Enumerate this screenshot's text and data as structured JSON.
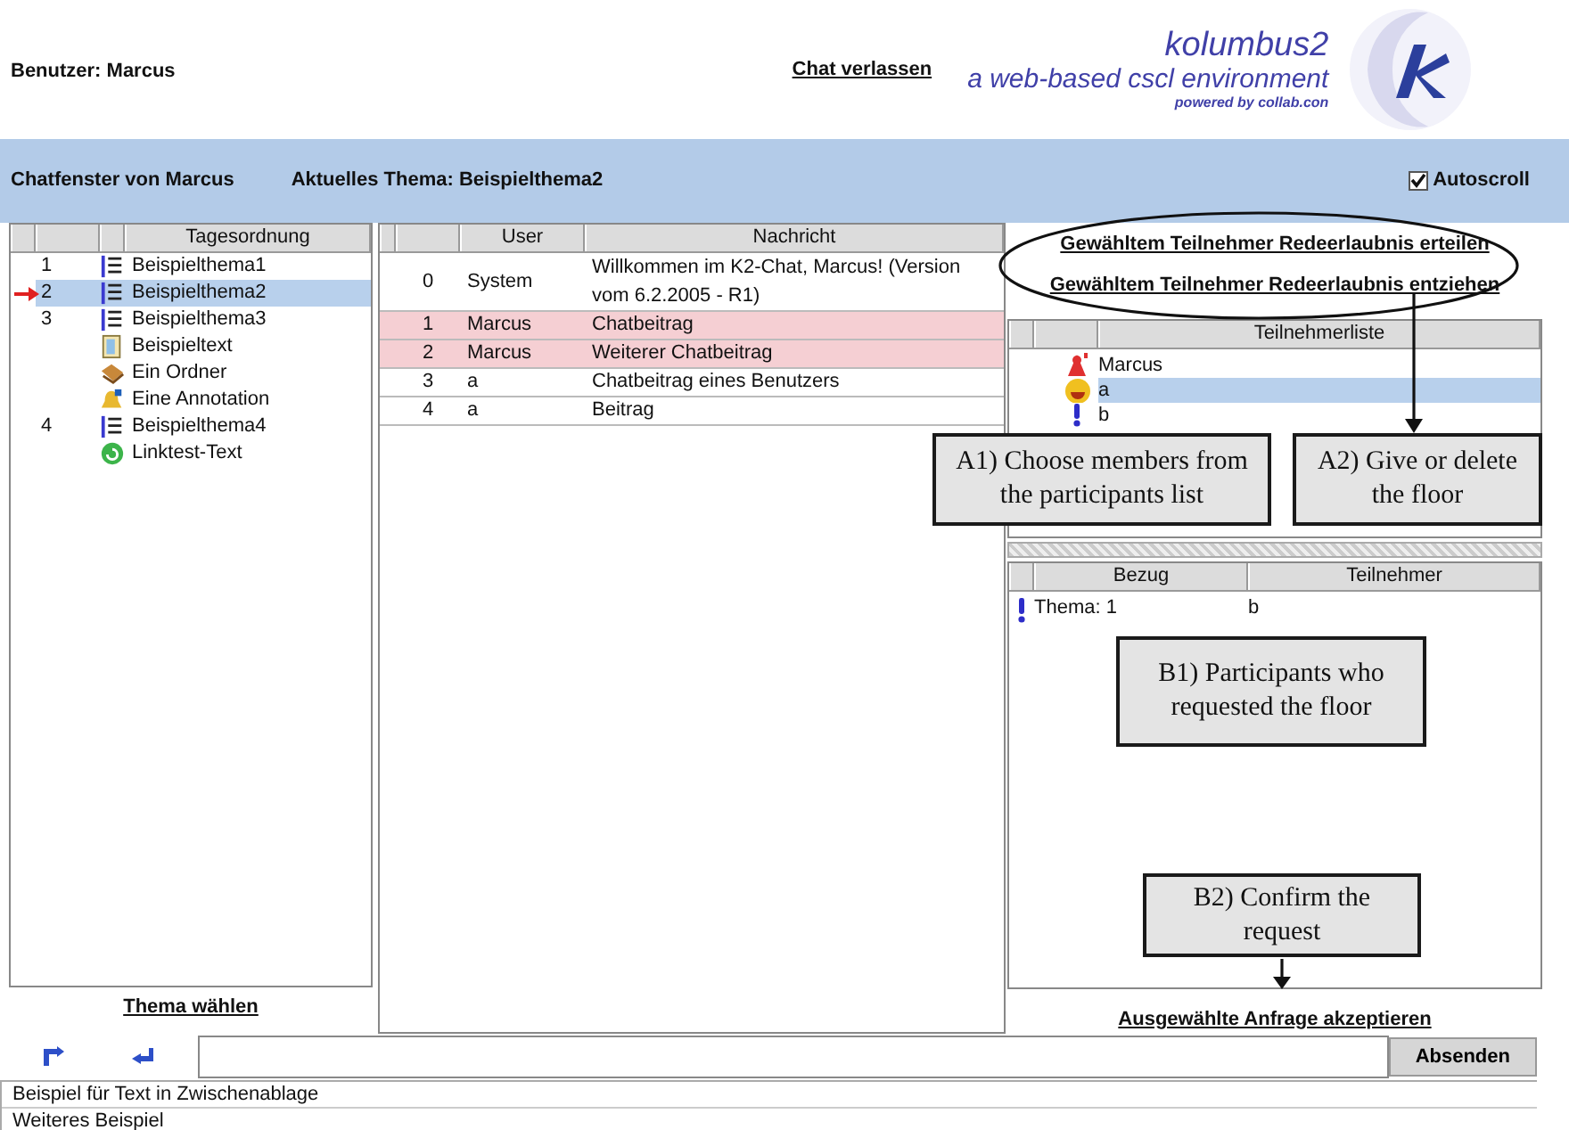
{
  "header": {
    "user": "Benutzer: Marcus",
    "leave_link": "Chat verlassen",
    "logo": {
      "title": "kolumbus2",
      "subtitle": "a web-based cscl environment",
      "credit": "powered by collab.con"
    }
  },
  "topic_bar": {
    "window_label": "Chatfenster von Marcus",
    "current_topic": "Aktuelles Thema: Beispielthema2",
    "autoscroll": {
      "label": "Autoscroll",
      "checked": true
    }
  },
  "agenda": {
    "column": "Tagesordnung",
    "items": [
      {
        "number": "1",
        "kind": "topic",
        "label": "Beispielthema1",
        "selected": false,
        "current": false
      },
      {
        "number": "2",
        "kind": "topic",
        "label": "Beispielthema2",
        "selected": true,
        "current": true
      },
      {
        "number": "3",
        "kind": "topic",
        "label": "Beispielthema3",
        "selected": false,
        "current": false
      },
      {
        "kind": "text",
        "label": "Beispieltext",
        "selected": false,
        "current": false
      },
      {
        "kind": "folder",
        "label": "Ein Ordner",
        "selected": false,
        "current": false
      },
      {
        "kind": "annotation",
        "label": "Eine Annotation",
        "selected": false,
        "current": false
      },
      {
        "number": "4",
        "kind": "topic",
        "label": "Beispielthema4",
        "selected": false,
        "current": false
      },
      {
        "kind": "link",
        "label": "Linktest-Text",
        "selected": false,
        "current": false
      }
    ],
    "link": "Thema wählen"
  },
  "chat": {
    "columns": [
      "User",
      "Nachricht"
    ],
    "messages": [
      {
        "number": "0",
        "user": "System",
        "text": "Willkommen im K2-Chat, Marcus! (Version vom 6.2.2005 - R1)",
        "own": false
      },
      {
        "number": "1",
        "user": "Marcus",
        "text": "Chatbeitrag",
        "own": true
      },
      {
        "number": "2",
        "user": "Marcus",
        "text": "Weiterer Chatbeitrag",
        "own": true
      },
      {
        "number": "3",
        "user": "a",
        "text": "Chatbeitrag eines Benutzers",
        "own": false
      },
      {
        "number": "4",
        "user": "a",
        "text": "Beitrag",
        "own": false
      }
    ]
  },
  "participants": {
    "links": [
      "Gewähltem Teilnehmer Redeerlaubnis erteilen",
      "Gewähltem Teilnehmer Redeerlaubnis entziehen"
    ],
    "column": "Teilnehmerliste",
    "members": [
      {
        "name": "Marcus",
        "kind": "moderator",
        "selected": false
      },
      {
        "name": "a",
        "kind": "speaker",
        "selected": true
      },
      {
        "name": "b",
        "kind": "requesting",
        "selected": false
      }
    ]
  },
  "requests": {
    "columns": [
      "Bezug",
      "Teilnehmer"
    ],
    "rows": [
      {
        "reference": "Thema: 1",
        "participant": "b"
      }
    ],
    "link": "Ausgewählte Anfrage akzeptieren"
  },
  "input": {
    "button": "Absenden"
  },
  "clipboard": [
    "Beispiel für Text in Zwischenablage",
    "Weiteres Beispiel"
  ],
  "annotations": [
    {
      "label": "A1) Choose members from the participants list"
    },
    {
      "label": "A2) Give or delete the floor"
    },
    {
      "label": "B1) Participants who requested the floor"
    },
    {
      "label": "B2) Confirm the request"
    }
  ]
}
